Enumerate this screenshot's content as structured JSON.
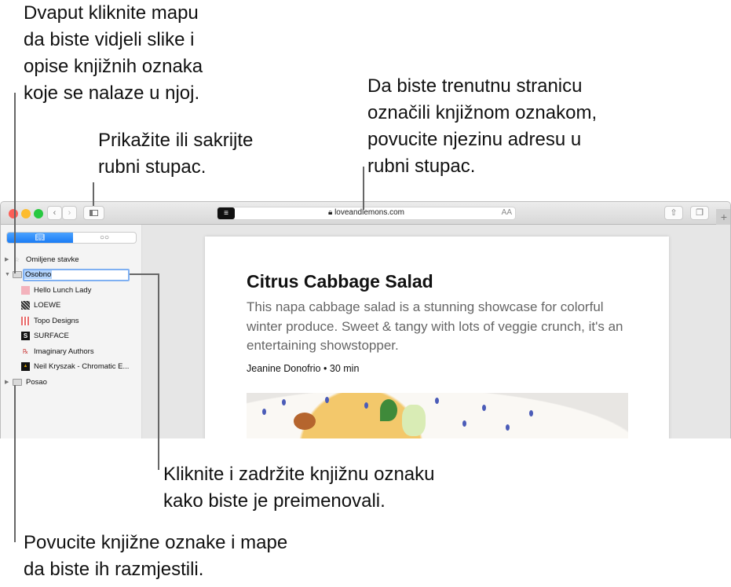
{
  "callouts": {
    "folder": "Dvaput kliknite mapu\nda biste vidjeli slike i\nopise knjižnih oznaka\nkoje se nalaze u njoj.",
    "sidebar_toggle": "Prikažite ili sakrijte\nrubni stupac.",
    "address": "Da biste trenutnu stranicu\noznačili knjižnom oznakom,\npovucite njezinu adresu u\nrubni stupac.",
    "rename": "Kliknite i zadržite knjižnu oznaku\nkako biste je preimenovali.",
    "arrange": "Povucite knjižne oznake i mape\nda biste ih razmjestili."
  },
  "toolbar": {
    "url": "loveandlemons.com",
    "text_size": "AA",
    "reader_icon": "reader-icon",
    "lock_icon": "lock-icon"
  },
  "sidebar": {
    "tabs": [
      {
        "icon": "book-icon",
        "glyph": "📖"
      },
      {
        "icon": "glasses-icon",
        "glyph": "○○"
      }
    ],
    "favorites": "Omiljene stavke",
    "editing_folder": "Osobno",
    "bookmarks": [
      "Hello Lunch Lady",
      "LOEWE",
      "Topo Designs",
      "SURFACE",
      "Imaginary Authors",
      "Neil Kryszak - Chromatic E..."
    ],
    "other_folder": "Posao"
  },
  "article": {
    "title": "Citrus Cabbage Salad",
    "description": "This napa cabbage salad is a stunning showcase for colorful winter produce. Sweet & tangy with lots of veggie crunch, it's an entertaining showstopper.",
    "author": "Jeanine Donofrio",
    "separator": "•",
    "time": "30 min"
  },
  "colors": {
    "accent": "#1a7cf5",
    "close": "#fc5f57",
    "minimize": "#fdbc2e",
    "zoom": "#28c840"
  }
}
